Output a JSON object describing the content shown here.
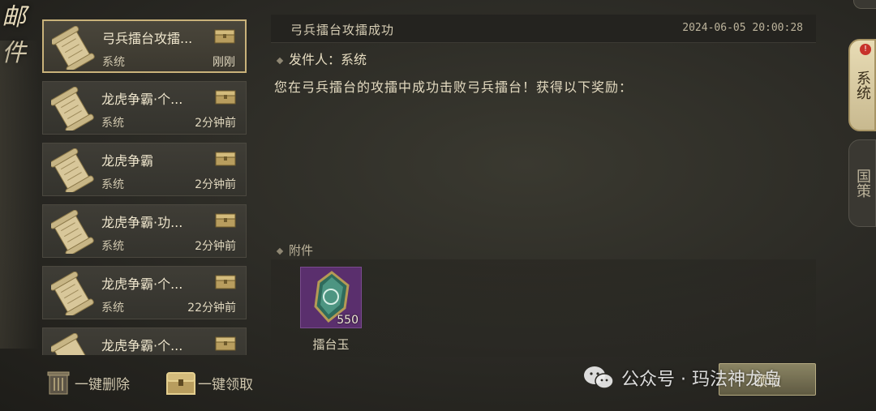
{
  "header": {
    "title": "邮件"
  },
  "mail_list": [
    {
      "subject": "弓兵擂台攻擂...",
      "sender": "系统",
      "time": "刚刚",
      "selected": true
    },
    {
      "subject": "龙虎争霸·个...",
      "sender": "系统",
      "time": "2分钟前",
      "selected": false
    },
    {
      "subject": "龙虎争霸",
      "sender": "系统",
      "time": "2分钟前",
      "selected": false
    },
    {
      "subject": "龙虎争霸·功...",
      "sender": "系统",
      "time": "2分钟前",
      "selected": false
    },
    {
      "subject": "龙虎争霸·个...",
      "sender": "系统",
      "time": "22分钟前",
      "selected": false
    },
    {
      "subject": "龙虎争霸·个...",
      "sender": "",
      "time": "",
      "selected": false
    }
  ],
  "actions": {
    "delete_all": "一键删除",
    "claim_all": "一键领取",
    "claim": "领取"
  },
  "detail": {
    "title": "弓兵擂台攻擂成功",
    "timestamp": "2024-06-05 20:00:28",
    "sender_label": "发件人：",
    "sender": "系统",
    "body": "您在弓兵擂台的攻擂中成功击败弓兵擂台！获得以下奖励：",
    "attachments_label": "附件",
    "attachment": {
      "name": "擂台玉",
      "count": "550",
      "icon": "jade-gem-icon"
    }
  },
  "tabs": [
    {
      "label": "系统",
      "active": true,
      "badge": "!"
    },
    {
      "label": "国策",
      "active": false
    }
  ],
  "watermark": "公众号 · 玛法神龙岛",
  "colors": {
    "accent": "#c9b27a",
    "item_rarity": "#5a2f6d",
    "badge": "#c7322b"
  }
}
